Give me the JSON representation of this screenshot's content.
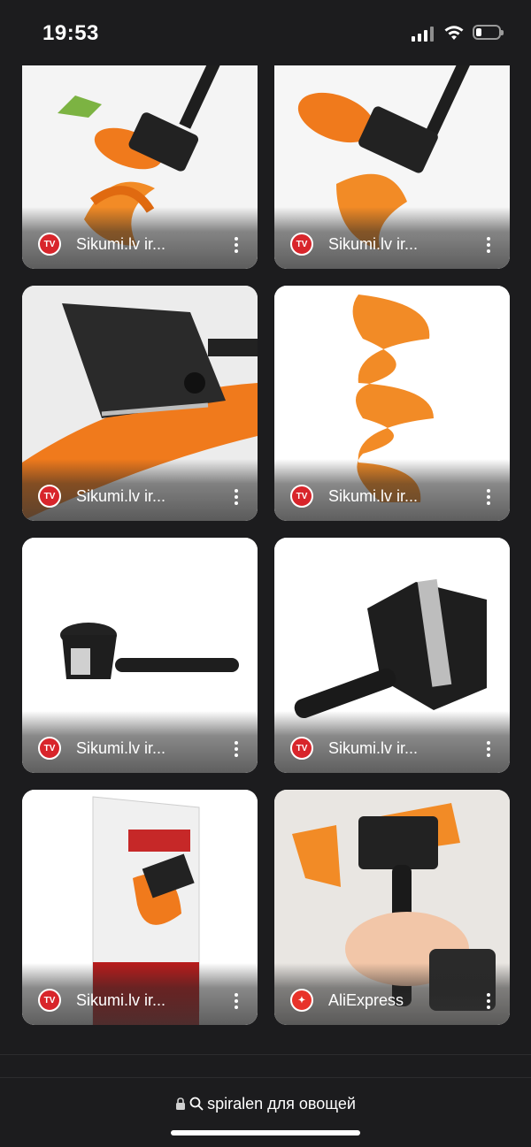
{
  "status_bar": {
    "time": "19:53"
  },
  "results": [
    {
      "source": "Sikumi.lv ir...",
      "icon_text": "TV",
      "icon": "as-seen-on-tv-icon"
    },
    {
      "source": "Sikumi.lv ir...",
      "icon_text": "TV",
      "icon": "as-seen-on-tv-icon"
    },
    {
      "source": "Sikumi.lv ir...",
      "icon_text": "TV",
      "icon": "as-seen-on-tv-icon"
    },
    {
      "source": "Sikumi.lv ir...",
      "icon_text": "TV",
      "icon": "as-seen-on-tv-icon"
    },
    {
      "source": "Sikumi.lv ir...",
      "icon_text": "TV",
      "icon": "as-seen-on-tv-icon"
    },
    {
      "source": "Sikumi.lv ir...",
      "icon_text": "TV",
      "icon": "as-seen-on-tv-icon"
    },
    {
      "source": "Sikumi.lv ir...",
      "icon_text": "TV",
      "icon": "as-seen-on-tv-icon"
    },
    {
      "source": "AliExpress",
      "icon_text": "✦",
      "icon": "aliexpress-icon"
    }
  ],
  "address_bar": {
    "query": "spiralen для овощей"
  },
  "colors": {
    "carrot": "#f07a1c",
    "tool": "#222222",
    "background": "#1c1c1e"
  }
}
